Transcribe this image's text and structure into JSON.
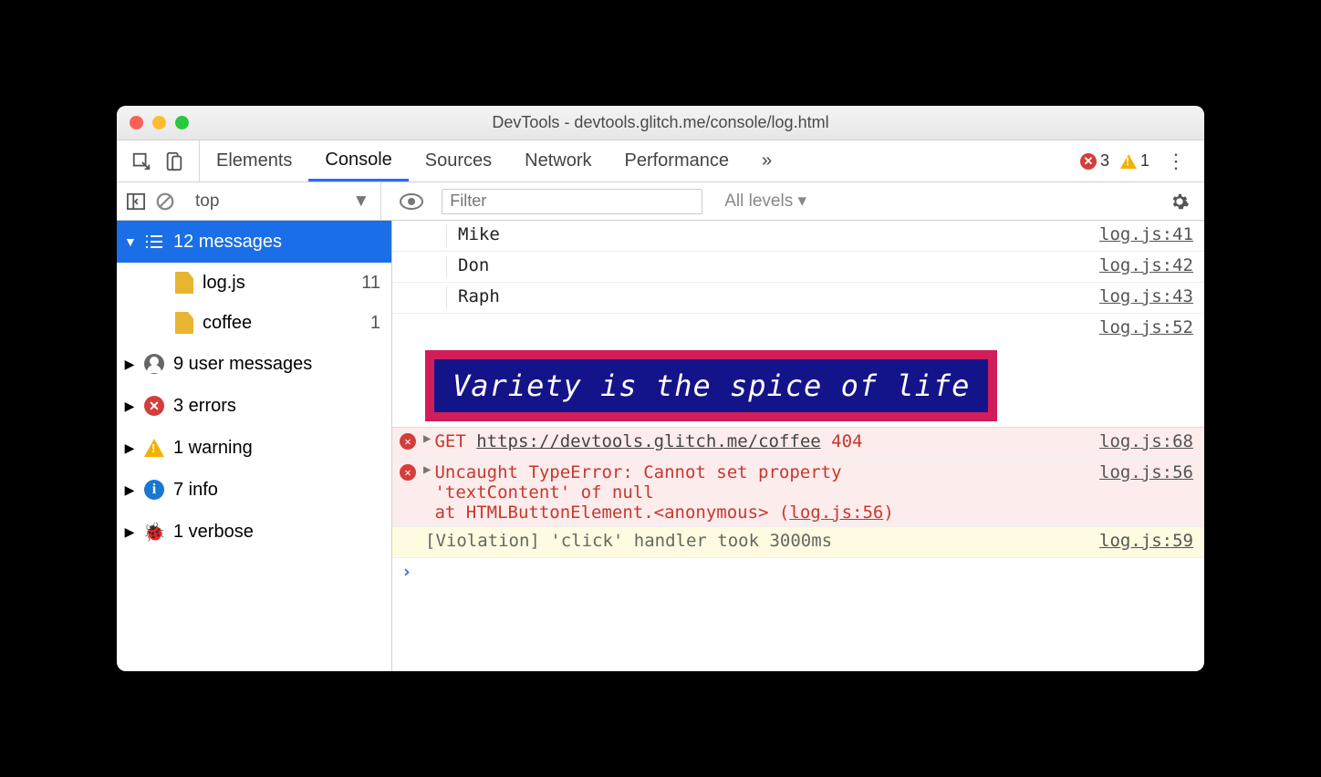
{
  "window": {
    "title": "DevTools - devtools.glitch.me/console/log.html"
  },
  "tabs": {
    "items": [
      "Elements",
      "Console",
      "Sources",
      "Network",
      "Performance"
    ],
    "active": "Console",
    "more": "»",
    "error_count": "3",
    "warning_count": "1"
  },
  "toolbar": {
    "context": "top",
    "filter_placeholder": "Filter",
    "levels": "All levels ▾"
  },
  "sidebar": {
    "messages": {
      "label": "12 messages"
    },
    "files": [
      {
        "name": "log.js",
        "count": "11"
      },
      {
        "name": "coffee",
        "count": "1"
      }
    ],
    "groups": [
      {
        "key": "user",
        "label": "9 user messages"
      },
      {
        "key": "errors",
        "label": "3 errors"
      },
      {
        "key": "warning",
        "label": "1 warning"
      },
      {
        "key": "info",
        "label": "7 info"
      },
      {
        "key": "verbose",
        "label": "1 verbose"
      }
    ]
  },
  "console": {
    "rows": [
      {
        "text": "Mike",
        "src": "log.js:41"
      },
      {
        "text": "Don",
        "src": "log.js:42"
      },
      {
        "text": "Raph",
        "src": "log.js:43"
      }
    ],
    "banner_src": "log.js:52",
    "banner_text": "Variety is the spice of life",
    "get_row": {
      "method": "GET",
      "url": "https://devtools.glitch.me/coffee",
      "status": "404",
      "src": "log.js:68"
    },
    "typeerror": {
      "line1": "Uncaught TypeError: Cannot set property",
      "line2": "'textContent' of null",
      "line3_pre": "    at HTMLButtonElement.<anonymous> (",
      "line3_link": "log.js:56",
      "line3_post": ")",
      "src": "log.js:56"
    },
    "violation": {
      "text": "[Violation] 'click' handler took 3000ms",
      "src": "log.js:59"
    },
    "prompt": "›"
  }
}
